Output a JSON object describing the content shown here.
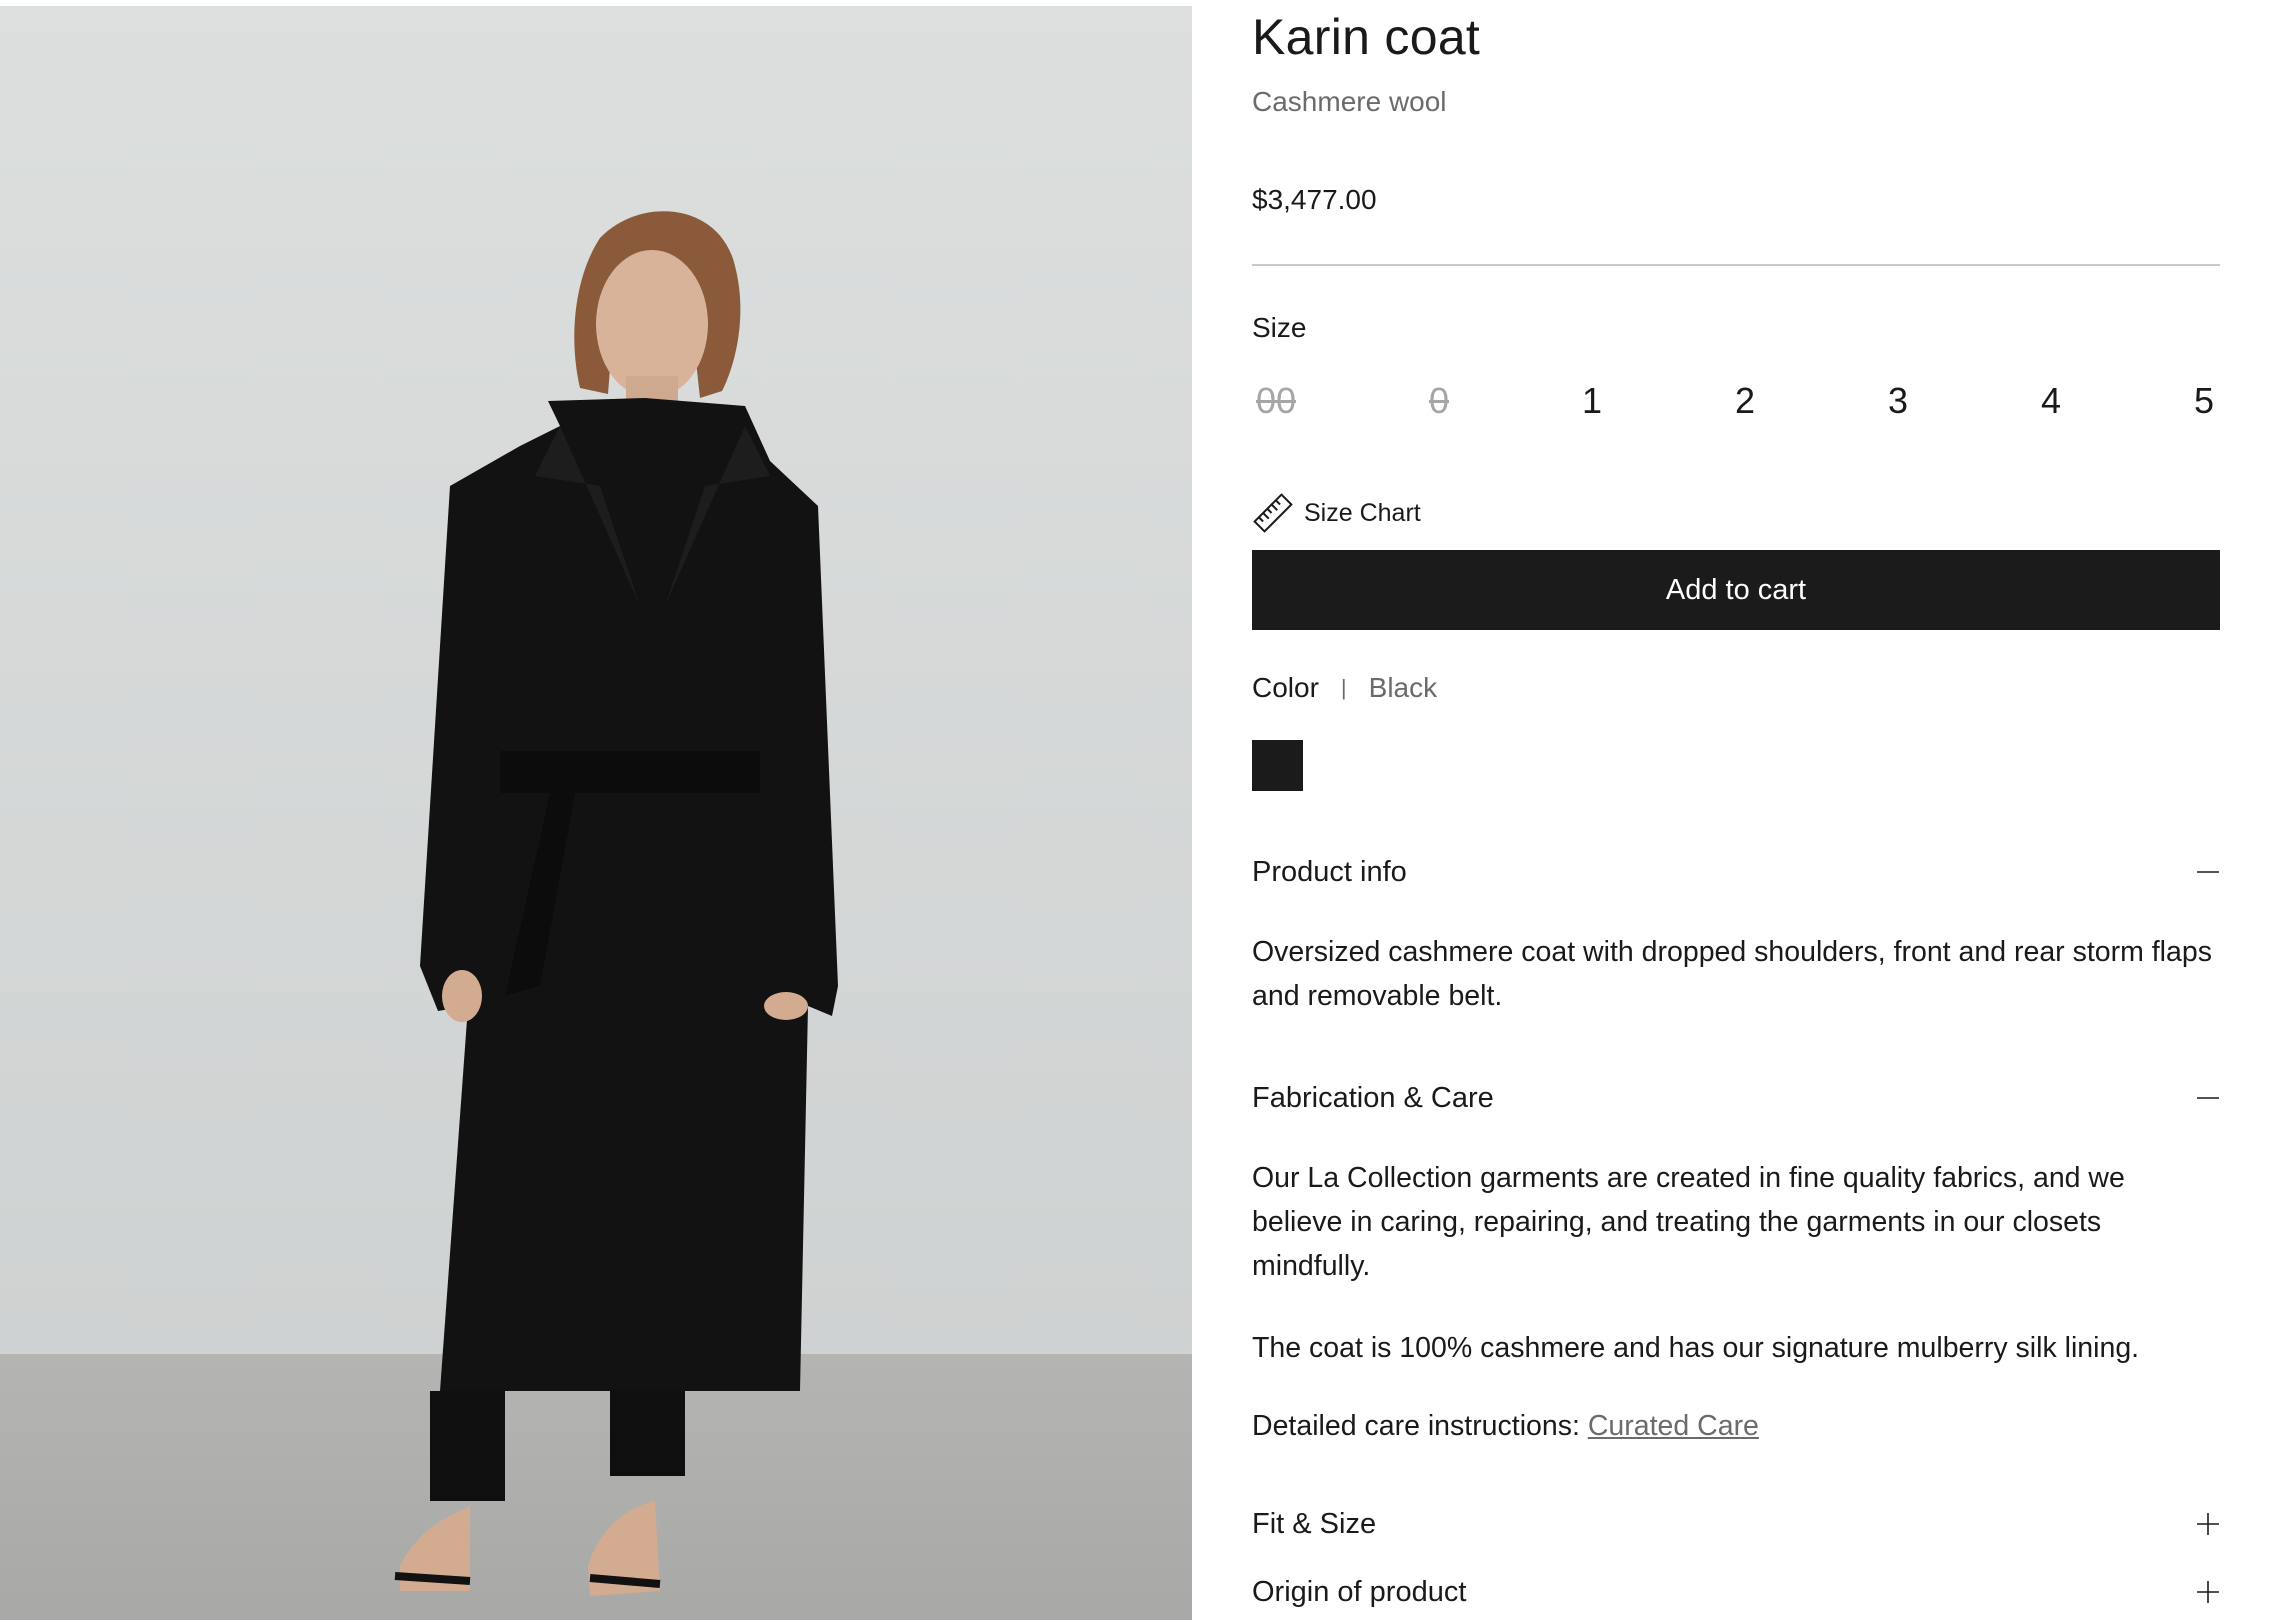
{
  "product": {
    "image_alt": "Model wearing the Karin coat in black",
    "title": "Karin coat",
    "subtitle": "Cashmere wool",
    "price": "$3,477.00"
  },
  "size": {
    "label": "Size",
    "options": [
      {
        "label": "00",
        "available": false
      },
      {
        "label": "0",
        "available": false
      },
      {
        "label": "1",
        "available": true
      },
      {
        "label": "2",
        "available": true
      },
      {
        "label": "3",
        "available": true
      },
      {
        "label": "4",
        "available": true
      },
      {
        "label": "5",
        "available": true
      }
    ],
    "chart_link": "Size Chart",
    "chart_icon": "ruler-icon"
  },
  "cart": {
    "add_label": "Add to cart"
  },
  "color": {
    "label": "Color",
    "separator": "|",
    "selected": "Black",
    "swatch_hex": "#1b1b1b"
  },
  "accordions": {
    "product_info": {
      "title": "Product info",
      "state": "expanded",
      "icon": "minus-icon",
      "body": "Oversized cashmere coat with dropped shoulders, front and rear storm flaps and removable belt."
    },
    "fabrication_care": {
      "title": "Fabrication & Care",
      "state": "expanded",
      "icon": "minus-icon",
      "body_1": "Our La Collection garments are created in fine quality fabrics, and we believe in caring, repairing, and treating the garments in our closets mindfully.",
      "body_2": "The coat is 100% cashmere and has our signature mulberry silk lining.",
      "care_prefix": "Detailed care instructions: ",
      "care_link": "Curated Care"
    },
    "fit_size": {
      "title": "Fit & Size",
      "state": "collapsed",
      "icon": "plus-icon"
    },
    "origin": {
      "title": "Origin of product",
      "state": "collapsed",
      "icon": "plus-icon"
    }
  },
  "colors": {
    "text": "#1a1a1a",
    "muted": "#6b6b6b",
    "disabled": "#a6a6a6",
    "button": "#1b1b1b",
    "divider": "#c9c9c9"
  }
}
